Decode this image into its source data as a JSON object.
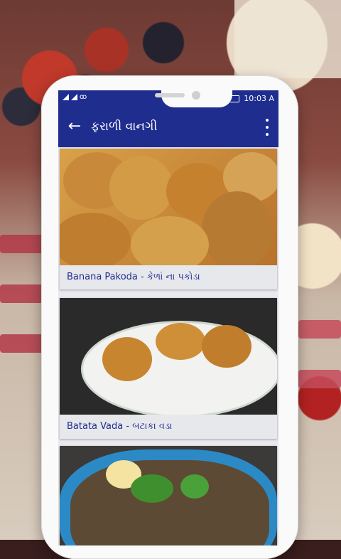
{
  "status_bar": {
    "time": "10:03 A",
    "icons": [
      "signal-icon",
      "voicemail-icon",
      "battery-icon"
    ]
  },
  "app_bar": {
    "title": "ફરાળી વાનગી",
    "back_icon": "←"
  },
  "recipes": [
    {
      "label": "Banana Pakoda - કેળાં ના પકોડા"
    },
    {
      "label": "Batata Vada - બટાકા વડા"
    },
    {
      "label": ""
    }
  ],
  "colors": {
    "primary": "#1f2d8f",
    "label_bg": "#e7e8ec"
  }
}
